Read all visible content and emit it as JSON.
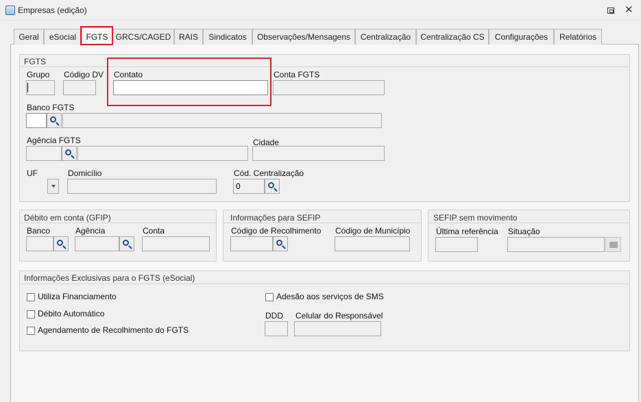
{
  "window": {
    "title": "Empresas (edição)",
    "close": "✕"
  },
  "tabs": [
    {
      "label": "Geral"
    },
    {
      "label": "eSocial"
    },
    {
      "label": "FGTS"
    },
    {
      "label": "GRCS/CAGED"
    },
    {
      "label": "RAIS"
    },
    {
      "label": "Sindicatos"
    },
    {
      "label": "Observações/Mensagens"
    },
    {
      "label": "Centralização"
    },
    {
      "label": "Centralização CS"
    },
    {
      "label": "Configurações"
    },
    {
      "label": "Relatórios"
    }
  ],
  "fgts": {
    "title": "FGTS",
    "grupo": {
      "label": "Grupo",
      "value": ""
    },
    "codigo_dv": {
      "label": "Código DV",
      "value": ""
    },
    "contato": {
      "label": "Contato",
      "value": ""
    },
    "conta_fgts": {
      "label": "Conta FGTS",
      "value": ""
    },
    "banco_fgts": {
      "label": "Banco FGTS",
      "code": "",
      "name": ""
    },
    "agencia_fgts": {
      "label": "Agência FGTS",
      "code": "",
      "name": ""
    },
    "cidade": {
      "label": "Cidade",
      "value": ""
    },
    "uf": {
      "label": "UF",
      "value": ""
    },
    "domicilio": {
      "label": "Domicílio",
      "value": ""
    },
    "cod_centralizacao": {
      "label": "Cód. Centralização",
      "value": "0"
    }
  },
  "debito": {
    "title": "Débito em conta (GFIP)",
    "banco": {
      "label": "Banco",
      "value": ""
    },
    "agencia": {
      "label": "Agência",
      "value": ""
    },
    "conta": {
      "label": "Conta",
      "value": ""
    }
  },
  "sefip": {
    "title": "Informações para SEFIP",
    "codigo_recolhimento": {
      "label": "Código de Recolhimento",
      "value": ""
    },
    "codigo_municipio": {
      "label": "Código de Município",
      "value": ""
    }
  },
  "sefip_sem_mov": {
    "title": "SEFIP sem movimento",
    "ultima_referencia": {
      "label": "Última referência",
      "value": ""
    },
    "situacao": {
      "label": "Situação",
      "value": ""
    }
  },
  "exclusivas": {
    "title": "Informações Exclusivas para o FGTS (eSocial)",
    "utiliza_financiamento": "Utiliza Financiamento",
    "debito_automatico": "Débito Automático",
    "agendamento": "Agendamento de Recolhimento do FGTS",
    "adesao_sms": "Adesão aos serviços de SMS",
    "ddd": {
      "label": "DDD",
      "value": ""
    },
    "celular": {
      "label": "Celular do Responsável",
      "value": ""
    }
  }
}
